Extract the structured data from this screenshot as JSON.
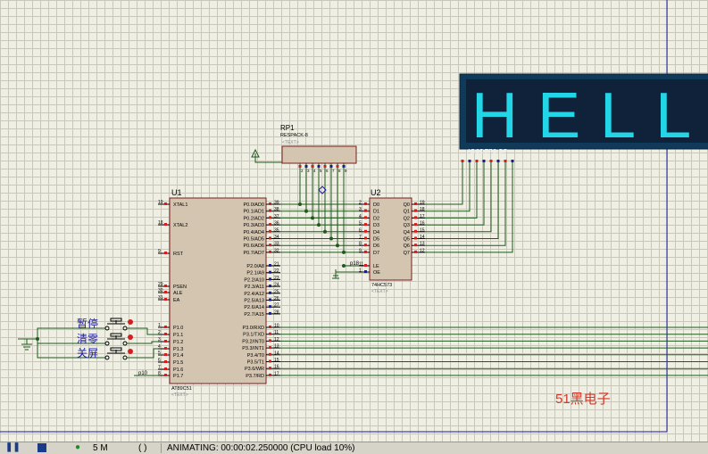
{
  "display": {
    "text": "HELLO-",
    "segment_pins": "ABCDEFG  DP",
    "colors": {
      "frame": "#0f3a5a",
      "background": "#10223a",
      "segment_on": "#22d6e8"
    }
  },
  "rp1": {
    "ref": "RP1",
    "model": "RESPACK-8",
    "text": "<TEXT>",
    "pins": [
      "2",
      "3",
      "4",
      "5",
      "6",
      "7",
      "8",
      "9"
    ]
  },
  "u1": {
    "ref": "U1",
    "model": "AT89C51",
    "text": "<TEXT>",
    "left_pins": [
      {
        "num": "19",
        "name": "XTAL1"
      },
      {
        "num": "18",
        "name": "XTAL2"
      },
      {
        "num": "9",
        "name": "RST"
      },
      {
        "num": "29",
        "name": "PSEN"
      },
      {
        "num": "30",
        "name": "ALE"
      },
      {
        "num": "31",
        "name": "EA"
      },
      {
        "num": "1",
        "name": "P1.0"
      },
      {
        "num": "2",
        "name": "P1.1"
      },
      {
        "num": "3",
        "name": "P1.2"
      },
      {
        "num": "4",
        "name": "P1.3"
      },
      {
        "num": "5",
        "name": "P1.4"
      },
      {
        "num": "6",
        "name": "P1.5"
      },
      {
        "num": "7",
        "name": "P1.6"
      },
      {
        "num": "8",
        "name": "P1.7"
      }
    ],
    "right_pins_p0": [
      {
        "num": "39",
        "name": "P0.0/AD0"
      },
      {
        "num": "38",
        "name": "P0.1/AD1"
      },
      {
        "num": "37",
        "name": "P0.2/AD2"
      },
      {
        "num": "36",
        "name": "P0.3/AD3"
      },
      {
        "num": "35",
        "name": "P0.4/AD4"
      },
      {
        "num": "34",
        "name": "P0.5/AD5"
      },
      {
        "num": "33",
        "name": "P0.6/AD6"
      },
      {
        "num": "32",
        "name": "P0.7/AD7"
      }
    ],
    "right_pins_p2": [
      {
        "num": "21",
        "name": "P2.0/A8"
      },
      {
        "num": "22",
        "name": "P2.1/A9"
      },
      {
        "num": "23",
        "name": "P2.2/A10"
      },
      {
        "num": "24",
        "name": "P2.3/A11"
      },
      {
        "num": "25",
        "name": "P2.4/A12"
      },
      {
        "num": "26",
        "name": "P2.5/A13"
      },
      {
        "num": "27",
        "name": "P2.6/A14"
      },
      {
        "num": "28",
        "name": "P2.7/A15"
      }
    ],
    "right_pins_p3": [
      {
        "num": "10",
        "name": "P3.0/RXD"
      },
      {
        "num": "11",
        "name": "P3.1/TXD"
      },
      {
        "num": "12",
        "name": "P3.2/INT0"
      },
      {
        "num": "13",
        "name": "P3.3/INT1"
      },
      {
        "num": "14",
        "name": "P3.4/T0"
      },
      {
        "num": "15",
        "name": "P3.5/T1"
      },
      {
        "num": "16",
        "name": "P3.6/WR"
      },
      {
        "num": "17",
        "name": "P3.7/RD"
      }
    ]
  },
  "u2": {
    "ref": "U2",
    "model": "74HC573",
    "text": "<TEXT>",
    "d_pins": [
      {
        "num": "2",
        "name": "D0"
      },
      {
        "num": "3",
        "name": "D1"
      },
      {
        "num": "4",
        "name": "D2"
      },
      {
        "num": "5",
        "name": "D3"
      },
      {
        "num": "6",
        "name": "D4"
      },
      {
        "num": "7",
        "name": "D5"
      },
      {
        "num": "8",
        "name": "D6"
      },
      {
        "num": "9",
        "name": "D7"
      }
    ],
    "q_pins": [
      {
        "num": "19",
        "name": "Q0"
      },
      {
        "num": "18",
        "name": "Q1"
      },
      {
        "num": "17",
        "name": "Q2"
      },
      {
        "num": "16",
        "name": "Q3"
      },
      {
        "num": "15",
        "name": "Q4"
      },
      {
        "num": "14",
        "name": "Q5"
      },
      {
        "num": "13",
        "name": "Q6"
      },
      {
        "num": "12",
        "name": "Q7"
      }
    ],
    "ctrl_pins": [
      {
        "num": "11",
        "name": "LE"
      },
      {
        "num": "1",
        "name": "OE"
      }
    ]
  },
  "buttons": [
    "暂停",
    "清零",
    "关屏"
  ],
  "net_labels": {
    "le": "p18",
    "p10": "p10"
  },
  "watermark": "51黑电子",
  "status": {
    "messages": "5 M",
    "paren": "( )",
    "animating": "ANIMATING: 00:00:02.250000 (CPU load 10%)"
  }
}
